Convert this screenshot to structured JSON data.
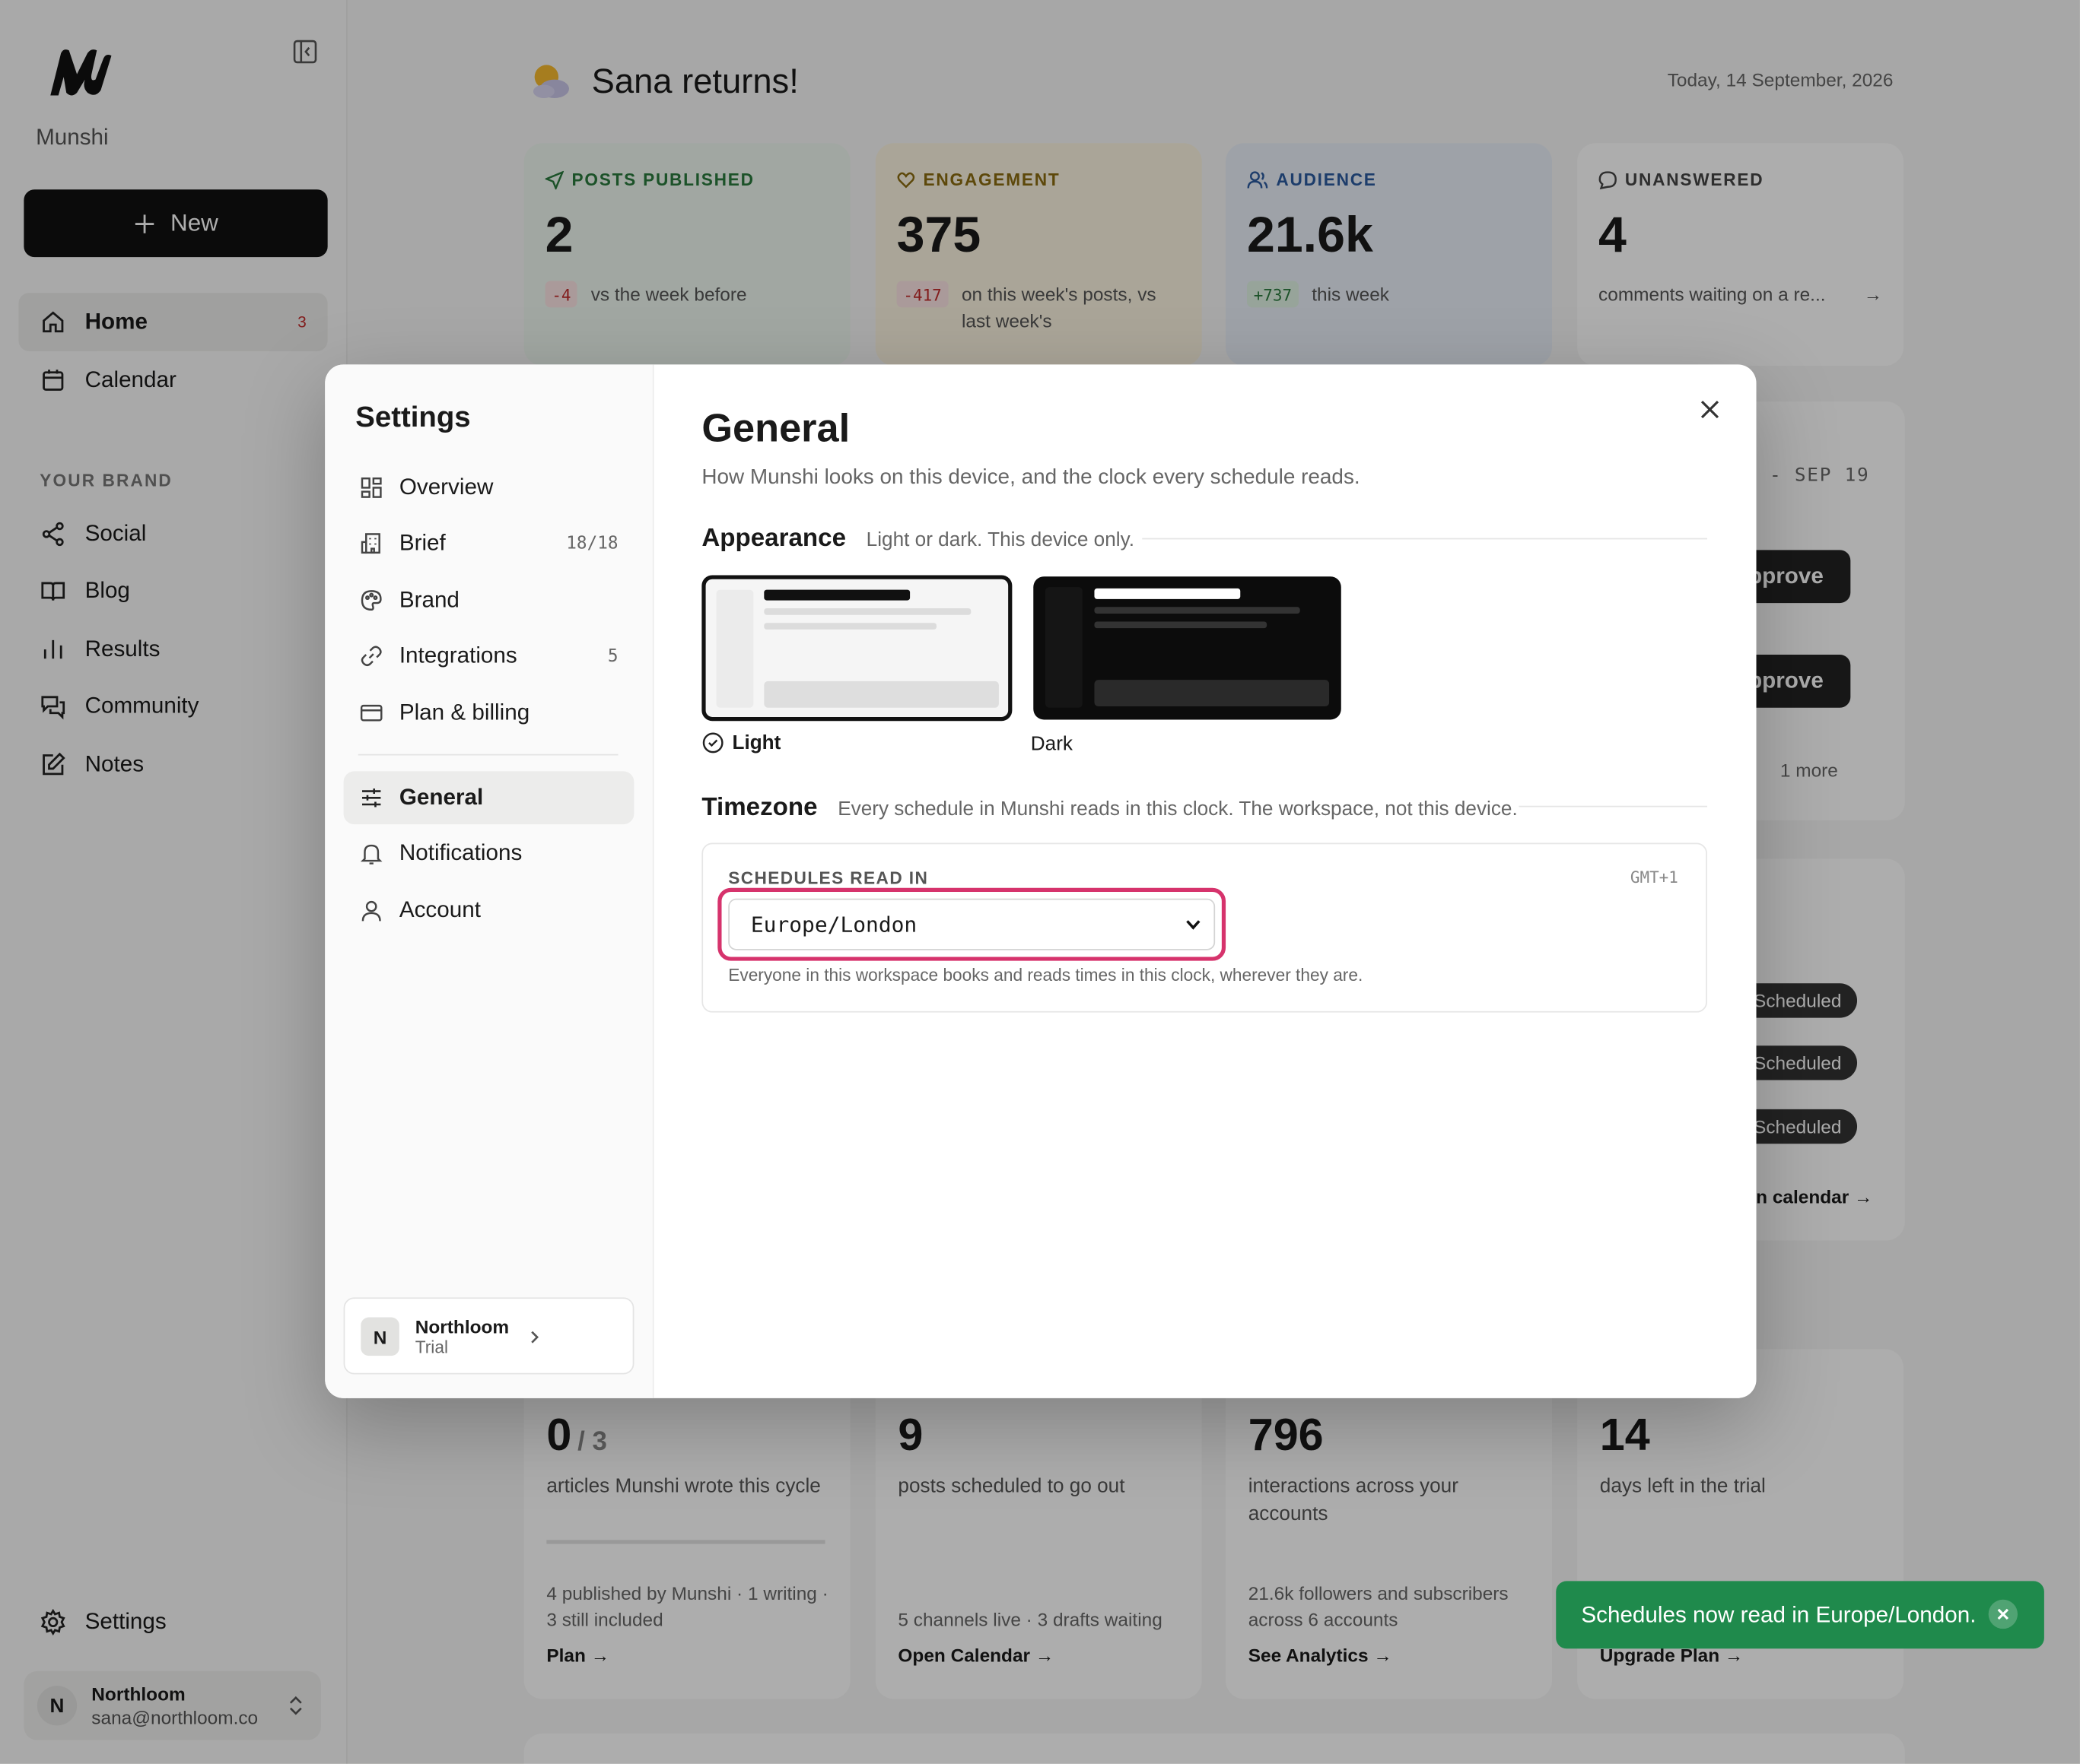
{
  "app": {
    "name": "Munshi"
  },
  "sidebar": {
    "new_label": "New",
    "nav": [
      {
        "label": "Home",
        "count": "3"
      },
      {
        "label": "Calendar"
      }
    ],
    "section_label": "YOUR BRAND",
    "brand_nav": [
      {
        "label": "Social"
      },
      {
        "label": "Blog"
      },
      {
        "label": "Results"
      },
      {
        "label": "Community"
      },
      {
        "label": "Notes"
      }
    ],
    "settings_label": "Settings",
    "user": {
      "initial": "N",
      "name": "Northloom",
      "email": "sana@northloom.co"
    }
  },
  "home": {
    "greeting": "Sana returns!",
    "date": "Today, 14 September, 2026",
    "stats": [
      {
        "label": "POSTS PUBLISHED",
        "value": "2",
        "delta": "-4",
        "sub": "vs the week before",
        "color": "#2a7a3d"
      },
      {
        "label": "ENGAGEMENT",
        "value": "375",
        "delta": "-417",
        "sub": "on this week's posts, vs last week's",
        "color": "#8a6a10"
      },
      {
        "label": "AUDIENCE",
        "value": "21.6k",
        "delta": "+737",
        "sub": "this week",
        "color": "#2c5a9e"
      },
      {
        "label": "UNANSWERED",
        "value": "4",
        "sub": "comments waiting on a re..."
      }
    ],
    "week_range": "- SEP 19",
    "approve_label": "pprove",
    "more_label": "1 more",
    "scheduled_label": "Scheduled",
    "calendar_link": "en calendar →",
    "cards": [
      {
        "value": "0",
        "of": "/ 3",
        "desc": "articles Munshi wrote this cycle",
        "foot": "4 published by Munshi · 1 writing · 3 still included",
        "link": "Plan →"
      },
      {
        "value": "9",
        "desc": "posts scheduled to go out",
        "foot": "5 channels live · 3 drafts waiting",
        "link": "Open Calendar →"
      },
      {
        "value": "796",
        "desc": "interactions across your accounts",
        "foot": "21.6k followers and subscribers across 6 accounts",
        "link": "See Analytics →"
      },
      {
        "value": "14",
        "desc": "days left in the trial",
        "foot": "",
        "link": "Upgrade Plan →"
      }
    ]
  },
  "settings": {
    "title": "Settings",
    "items": [
      {
        "label": "Overview"
      },
      {
        "label": "Brief",
        "count": "18/18"
      },
      {
        "label": "Brand"
      },
      {
        "label": "Integrations",
        "count": "5"
      },
      {
        "label": "Plan & billing"
      },
      {
        "label": "General"
      },
      {
        "label": "Notifications"
      },
      {
        "label": "Account"
      }
    ],
    "workspace": {
      "initial": "N",
      "name": "Northloom",
      "plan": "Trial"
    },
    "general": {
      "title": "General",
      "lead": "How Munshi looks on this device, and the clock every schedule reads.",
      "appearance": {
        "title": "Appearance",
        "subtitle": "Light or dark. This device only.",
        "light_label": "Light",
        "dark_label": "Dark",
        "selected": "Light"
      },
      "timezone": {
        "title": "Timezone",
        "subtitle": "Every schedule in Munshi reads in this clock. The workspace, not this device.",
        "field_label": "SCHEDULES READ IN",
        "offset": "GMT+1",
        "value": "Europe/London",
        "help": "Everyone in this workspace books and reads times in this clock, wherever they are."
      }
    }
  },
  "toast": {
    "message": "Schedules now read in Europe/London."
  }
}
